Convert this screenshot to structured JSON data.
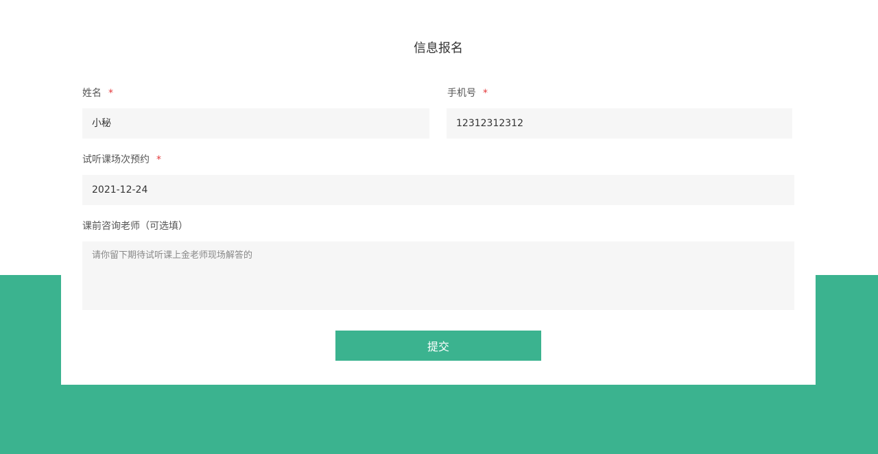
{
  "form": {
    "title": "信息报名",
    "name": {
      "label": "姓名",
      "required_mark": "*",
      "value": "小秘"
    },
    "phone": {
      "label": "手机号",
      "required_mark": "*",
      "value": "12312312312"
    },
    "session": {
      "label": "试听课场次预约",
      "required_mark": "*",
      "value": "2021-12-24"
    },
    "question": {
      "label": "课前咨询老师（可选填）",
      "placeholder": "请你留下期待试听课上金老师现场解答的"
    },
    "submit_label": "提交"
  },
  "colors": {
    "accent": "#3bb38f",
    "required": "#e4393c",
    "input_bg": "#f6f6f6"
  }
}
